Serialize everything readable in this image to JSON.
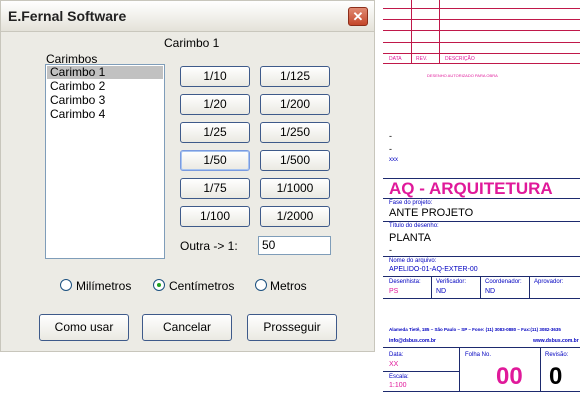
{
  "window": {
    "title": "E.Fernal Software",
    "close": "✕"
  },
  "dialog": {
    "caption": "Carimbo 1",
    "carimbos_label": "Carimbos",
    "carimbos": [
      "Carimbo 1",
      "Carimbo 2",
      "Carimbo 3",
      "Carimbo 4"
    ],
    "selected_index": 0,
    "scales_left": [
      "1/10",
      "1/20",
      "1/25",
      "1/50",
      "1/75",
      "1/100"
    ],
    "scales_right": [
      "1/125",
      "1/200",
      "1/250",
      "1/500",
      "1/1000",
      "1/2000"
    ],
    "outra_label": "Outra -> 1:",
    "outra_value": "50",
    "units": [
      "Milímetros",
      "Centímetros",
      "Metros"
    ],
    "selected_unit": "Centímetros",
    "buttons": {
      "como_usar": "Como usar",
      "cancelar": "Cancelar",
      "prosseguir": "Prosseguir"
    }
  },
  "title_block": {
    "rev_headers": {
      "data": "DATA",
      "rev": "REV.",
      "descricao": "DESCRIÇÃO"
    },
    "stamp_note": "DESENHO AUTORIZADO PARA OBRA",
    "dash1": "-",
    "dash2": "-",
    "xxx": "xxx",
    "discipline": "AQ - ARQUITETURA",
    "fase_label": "Fase do projeto:",
    "fase_value": "ANTE PROJETO",
    "titulo_label": "Título do desenho:",
    "titulo_value": "PLANTA",
    "titulo_dash": "-",
    "arquivo_label": "Nome do arquivo:",
    "arquivo_value": "APELIDO-01-AQ-EXTER-00",
    "desenhista_label": "Desenhista:",
    "desenhista_value": "PS",
    "verificador_label": "Verificador:",
    "verificador_value": "ND",
    "coordenador_label": "Coordenador:",
    "coordenador_value": "ND",
    "aprovador_label": "Aprovador:",
    "address": "Alameda Tietê, 185 – São Paulo – SP – Fone: (11) 3083-0880 – Fax:(11) 3082-3635",
    "email": "info@dsbus.com.br",
    "website": "www.dsbus.com.br",
    "data_label": "Data:",
    "data_value": "XX",
    "escala_label": "Escala:",
    "escala_value": "1:100",
    "folha_label": "Folha No.",
    "folha_value": "00",
    "revisao_label": "Revisão:",
    "revisao_value": "0"
  }
}
